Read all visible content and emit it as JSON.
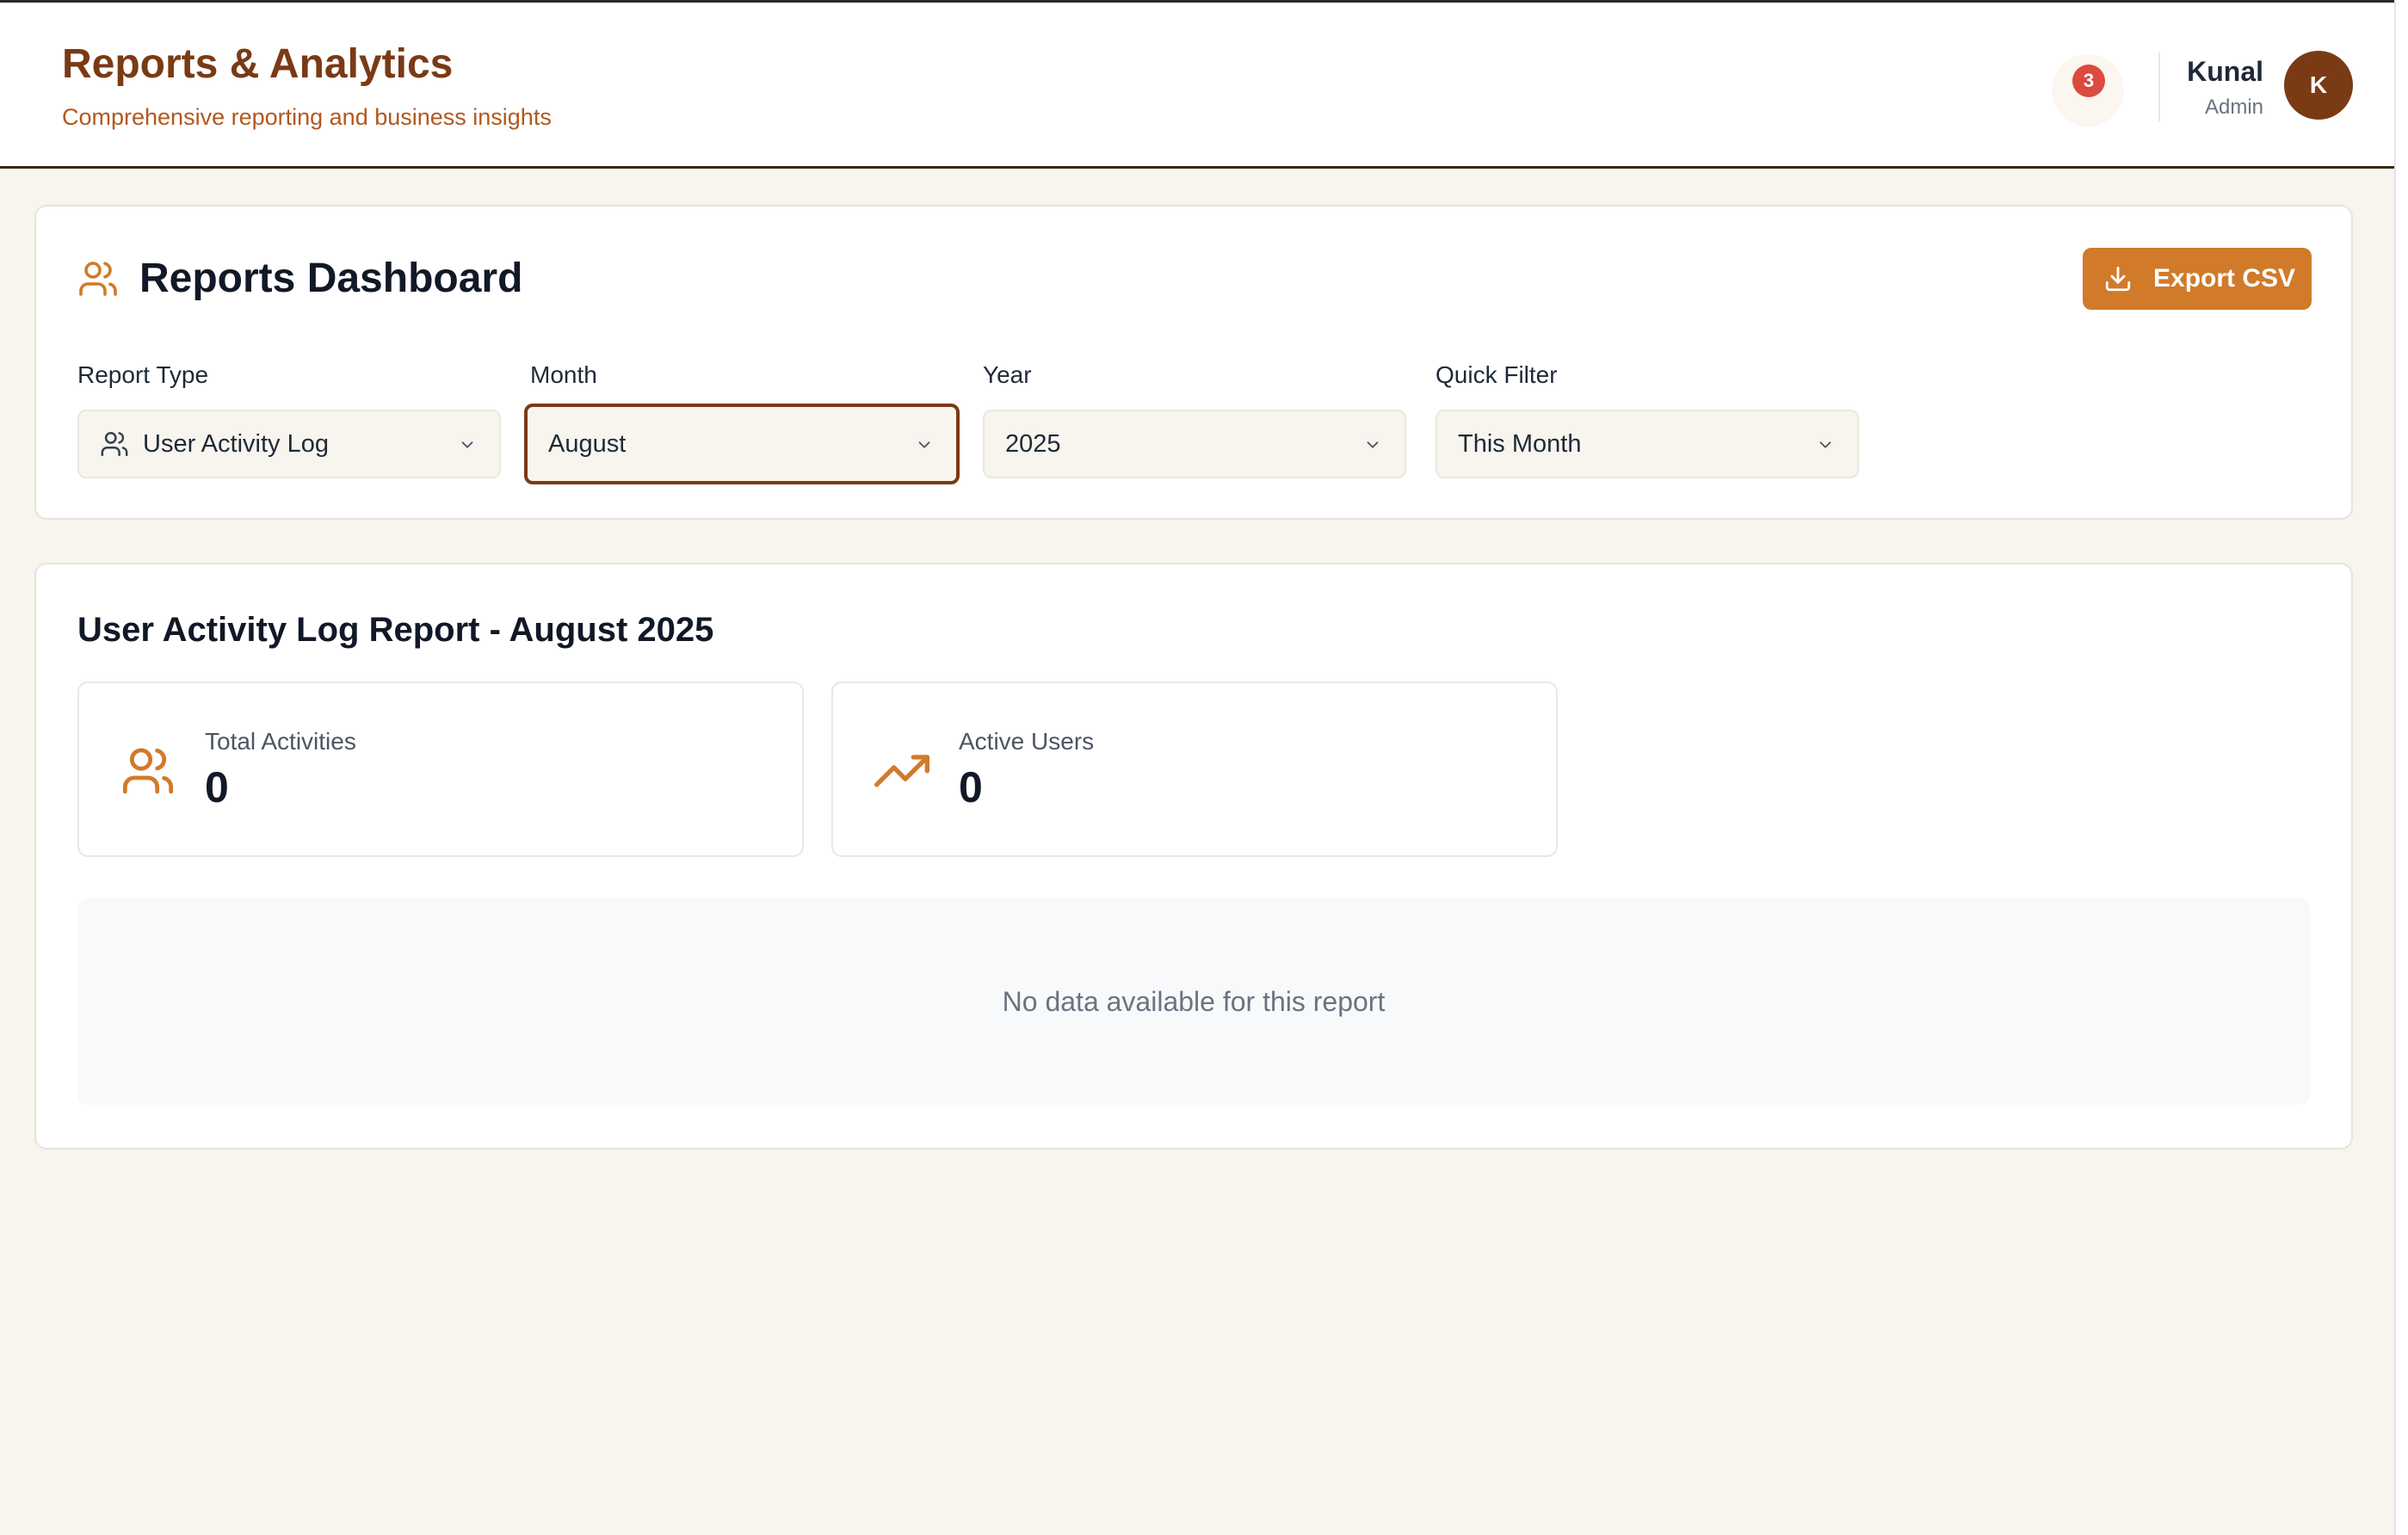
{
  "header": {
    "title": "Reports & Analytics",
    "subtitle": "Comprehensive reporting and business insights",
    "notifications_count": "3",
    "user": {
      "name": "Kunal",
      "role": "Admin",
      "avatar_initial": "K"
    }
  },
  "filters_card": {
    "title": "Reports Dashboard",
    "export_label": "Export CSV",
    "fields": {
      "report_type": {
        "label": "Report Type",
        "value": "User Activity Log"
      },
      "month": {
        "label": "Month",
        "value": "August"
      },
      "year": {
        "label": "Year",
        "value": "2025"
      },
      "quick_filter": {
        "label": "Quick Filter",
        "value": "This Month"
      }
    }
  },
  "report": {
    "title": "User Activity Log Report - August 2025",
    "stats": [
      {
        "label": "Total Activities",
        "value": "0",
        "icon": "users-icon"
      },
      {
        "label": "Active Users",
        "value": "0",
        "icon": "trending-up-icon"
      }
    ],
    "empty_message": "No data available for this report"
  },
  "colors": {
    "brand_dark": "#7a3a14",
    "brand_accent": "#d17a2a",
    "page_bg": "#f8f5ee",
    "badge": "#dc4a40"
  }
}
